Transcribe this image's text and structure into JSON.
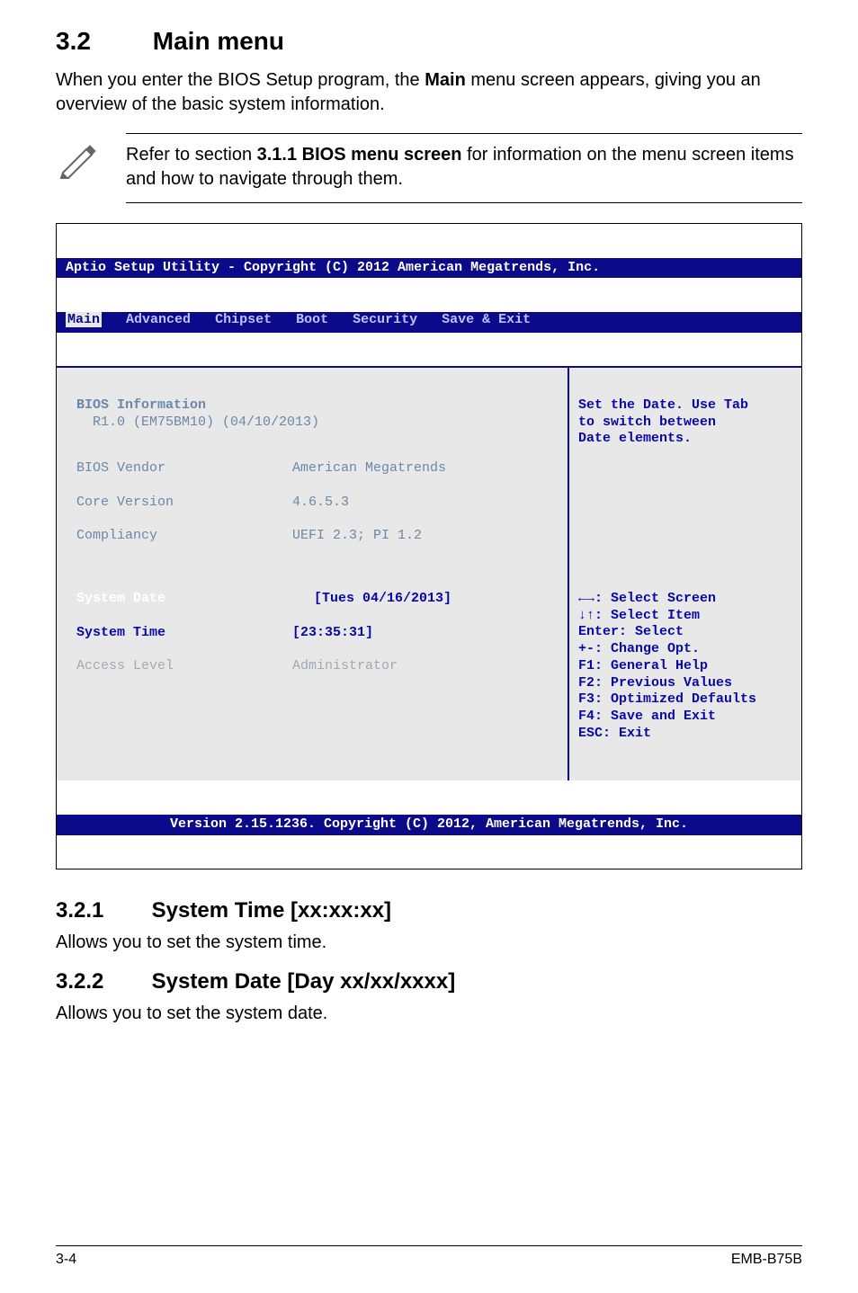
{
  "section": {
    "number": "3.2",
    "title": "Main menu",
    "intro_html": "When you enter the BIOS Setup program, the <b>Main</b> menu screen appears, giving you an overview of the basic system information."
  },
  "note": {
    "text_html": "Refer to section <b>3.1.1 BIOS menu screen</b> for information on the menu screen items and how to navigate through them."
  },
  "bios": {
    "header": "Aptio Setup Utility - Copyright (C) 2012 American Megatrends, Inc.",
    "tabs": [
      "Main",
      "Advanced",
      "Chipset",
      "Boot",
      "Security",
      "Save & Exit"
    ],
    "active_tab": "Main",
    "info": {
      "title": "BIOS Information",
      "version_line": "R1.0 (EM75BM10) (04/10/2013)",
      "vendor_label": "BIOS Vendor",
      "vendor_value": "American Megatrends",
      "core_label": "Core Version",
      "core_value": "4.6.5.3",
      "compliancy_label": "Compliancy",
      "compliancy_value": "UEFI 2.3; PI 1.2",
      "date_label": "System Date",
      "date_value": "[Tues 04/16/2013]",
      "time_label": "System Time",
      "time_value": "[23:35:31]",
      "access_label": "Access Level",
      "access_value": "Administrator"
    },
    "help": {
      "desc1": "Set the Date. Use Tab",
      "desc2": "to switch between",
      "desc3": "Date elements.",
      "k1": "←→: Select Screen",
      "k2": "↓↑: Select Item",
      "k3": "Enter: Select",
      "k4": "+-: Change Opt.",
      "k5": "F1: General Help",
      "k6": "F2: Previous Values",
      "k7": "F3: Optimized Defaults",
      "k8": "F4: Save and Exit",
      "k9": "ESC: Exit"
    },
    "footer": "Version 2.15.1236. Copyright (C) 2012, American Megatrends, Inc."
  },
  "sub1": {
    "number": "3.2.1",
    "title": "System Time [xx:xx:xx]",
    "body": "Allows you to set the system time."
  },
  "sub2": {
    "number": "3.2.2",
    "title": "System Date [Day xx/xx/xxxx]",
    "body": "Allows you to set the system date."
  },
  "footer": {
    "left": "3-4",
    "right": "EMB-B75B"
  }
}
